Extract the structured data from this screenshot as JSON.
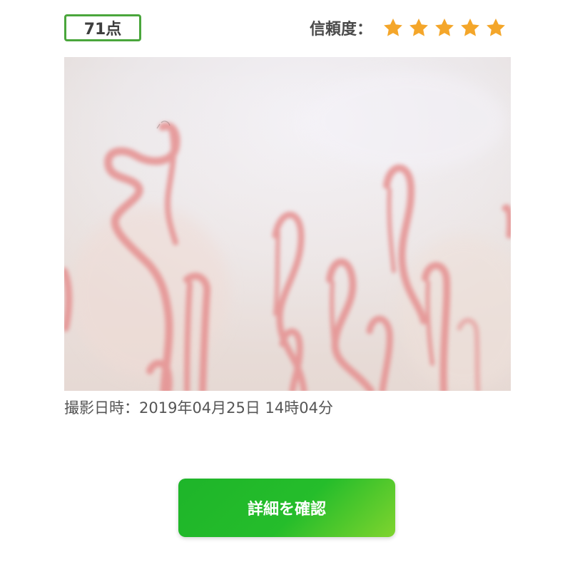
{
  "header": {
    "score": "71点",
    "reliability_label": "信頼度：",
    "reliability_stars": 5,
    "reliability_stars_max": 5
  },
  "photo": {
    "subject": "capillary-microscope-image"
  },
  "capture": {
    "datetime_text": "撮影日時：2019年04月25日 14時04分"
  },
  "actions": {
    "detail_label": "詳細を確認"
  },
  "colors": {
    "accent_green": "#1eb52a",
    "badge_border": "#4aa63c",
    "star": "#f4a62a"
  }
}
